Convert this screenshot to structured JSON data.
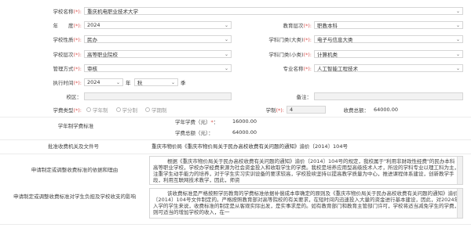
{
  "fields": {
    "school_name": {
      "label": "学校名称",
      "value": "重庆机电职业技术大学"
    },
    "year": {
      "label": "年　　度",
      "value": "2024"
    },
    "edu_level": {
      "label": "教育层次",
      "value": "职教本科"
    },
    "school_nature": {
      "label": "学校性质",
      "value": "民办"
    },
    "major_big": {
      "label": "学科门类(大类)",
      "value": "电子与信息大类"
    },
    "school_tier": {
      "label": "学校层次",
      "value": "高等职业院校"
    },
    "major_small": {
      "label": "学科门类(小类)",
      "value": "计算机类"
    },
    "mgmt_mode": {
      "label": "管理方式",
      "value": "审核"
    },
    "major_name": {
      "label": "专业名称",
      "value": "人工智能工程技术"
    },
    "exec_time": {
      "label": "执行时间",
      "year": "2024",
      "year_unit": "年",
      "season": "秋",
      "season_unit": "季"
    },
    "campus": {
      "label": "校区",
      "value": ""
    },
    "remark": {
      "label": "备注",
      "value": ""
    },
    "fee_type": {
      "label": "学费类型",
      "options": [
        "学年制",
        "学分制",
        "学期制"
      ]
    },
    "length": {
      "label": "学制",
      "value": "4"
    },
    "fee_total": {
      "label": "收费总额",
      "value": "64000.00"
    },
    "fee_standard_label": "学年制学费标准",
    "annual_fee": {
      "label": "学年学费（元）",
      "value": "16000.00"
    },
    "total_fee": {
      "label": "学费总额（元）",
      "value": "64000.00"
    },
    "approval": {
      "label": "批准收费机关及文件号",
      "value": "重庆市物价局《重庆市物价局关于民办高校收费有关问题的通知》渝价〔2014〕104号"
    },
    "basis": {
      "label": "申请制定或调整收费标准的依据和理由",
      "text": "根据《重庆市物价局关于民办高校收费有关问题的通知》渝价〔2014〕104号的规定，我校属于\"利用非财政性经费\"的民办本科高等职业学校，学校办学经费来源为社会资金投入和收取学生的学费。我校是培养应用型高级技术人才，所设的学科专业以理工科为主，注重学生动手能力的培养，对于学生实习实训设备的要求较高，学校投续坚持以提高教学质量为中心，推进课程体系建设，创新教学手段，利用互联网技术教学，因此，师资"
    },
    "impact": {
      "label": "申请制定或调整收费标准对学生负担及学校收支的影响",
      "text": "该收费标准是严格按照学历教育的学费标准依据补偿成本审确定的原则及《重庆市物价局关于民办高校收费有关问题的通知》渝价〔2014〕104号文件制定的。严格按照教育部对高等院校的有关要求，在短时间内迅速投入大量的资金进行基本建设，因此，对2024年入学的学生来说，收费标准的制定是从客观实际出发，是实事求是的。如有教育部门和教育主管部门许可，学校将适当减免学生的学费，则可适当的增加学校的收入，在一"
    },
    "req": "(*):",
    "colon": "：",
    "star": "*"
  },
  "colors": {
    "highlight": "#1f63c7",
    "required": "#d9534f"
  }
}
